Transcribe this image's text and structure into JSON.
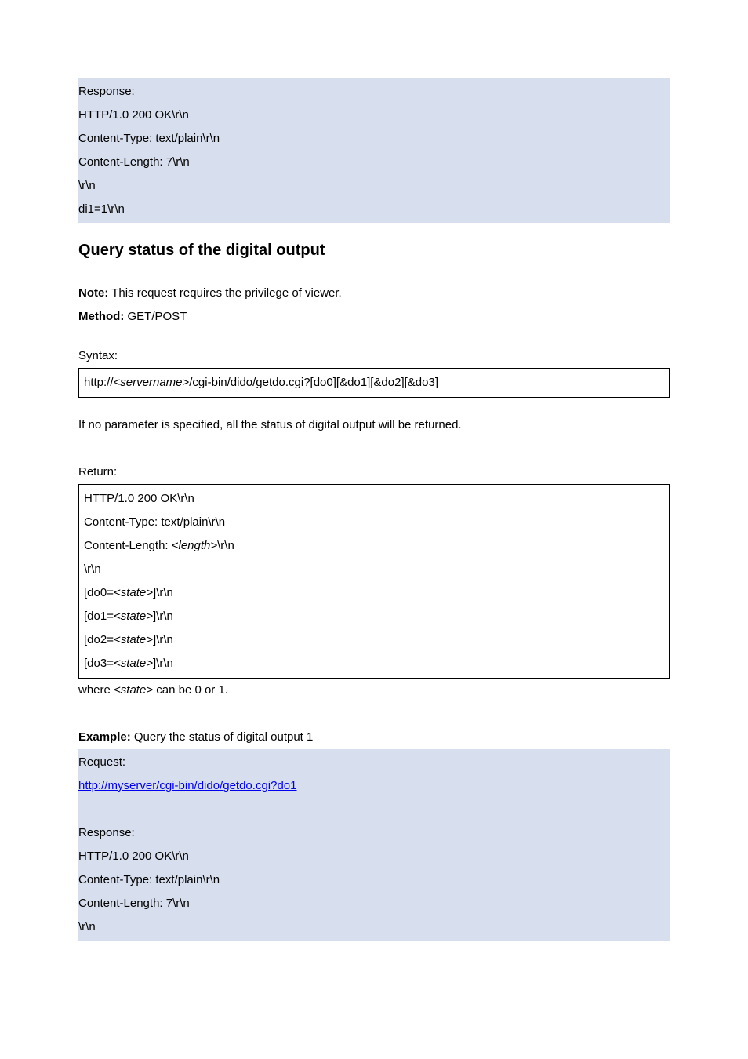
{
  "topShaded": {
    "l1": "Response:",
    "l2": "HTTP/1.0 200 OK\\r\\n",
    "l3": "Content-Type: text/plain\\r\\n",
    "l4": "Content-Length: 7\\r\\n",
    "l5": "\\r\\n",
    "l6": "di1=1\\r\\n"
  },
  "heading": "Query status of the digital output",
  "noteLabel": "Note:",
  "noteText": " This request requires the privilege of viewer.",
  "methodLabel": "Method:",
  "methodText": " GET/POST",
  "syntaxLabel": "Syntax:",
  "syntaxBox": {
    "pre": "http://<",
    "servername": "servername",
    "post": ">/cgi-bin/dido/getdo.cgi?[do0][&do1][&do2][&do3]"
  },
  "noParamText": "If no parameter is specified, all the status of digital output will be returned.",
  "returnLabel": "Return:",
  "returnBox": {
    "l1": "HTTP/1.0 200 OK\\r\\n",
    "l2": "Content-Type: text/plain\\r\\n",
    "l3a": "Content-Length: ",
    "l3b": "<length>",
    "l3c": "\\r\\n",
    "l4": "\\r\\n",
    "l5a": "[do0=",
    "l5b": "<state>",
    "l5c": "]\\r\\n",
    "l6a": "[do1=",
    "l6b": "<state>",
    "l6c": "]\\r\\n",
    "l7a": "[do2=",
    "l7b": "<state>",
    "l7c": "]\\r\\n",
    "l8a": "[do3=",
    "l8b": "<state>",
    "l8c": "]\\r\\n"
  },
  "whereA": "where ",
  "whereB": "<state>",
  "whereC": " can be 0 or 1.",
  "exampleLabel": "Example:",
  "exampleText": " Query the status of digital output 1",
  "bottomShaded": {
    "req": "Request:",
    "link": "http://myserver/cgi-bin/dido/getdo.cgi?do1",
    "resp": "Response:",
    "r1": "HTTP/1.0 200 OK\\r\\n",
    "r2": "Content-Type: text/plain\\r\\n",
    "r3": "Content-Length: 7\\r\\n",
    "r4": "\\r\\n"
  }
}
